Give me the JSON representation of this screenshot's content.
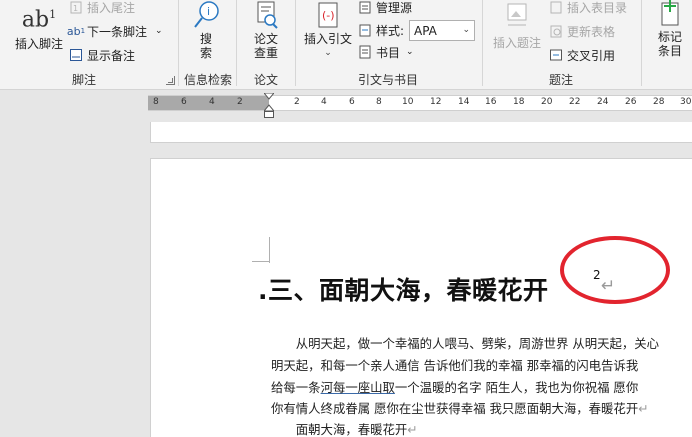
{
  "ribbon": {
    "footnotes": {
      "insert_footnote": "插入脚注",
      "insert_endnote": "插入尾注",
      "next_footnote": "下一条脚注",
      "show_notes": "显示备注",
      "group_label": "脚注"
    },
    "research": {
      "search": "搜\n索",
      "group_label": "信息检索"
    },
    "paper": {
      "check": "论文\n查重",
      "group_label": "论文"
    },
    "citations": {
      "insert_citation": "插入引文",
      "manage_sources": "管理源",
      "style_label": "样式:",
      "style_value": "APA",
      "bibliography": "书目",
      "group_label": "引文与书目"
    },
    "captions": {
      "insert_caption": "插入题注",
      "insert_table_of_figures": "插入表目录",
      "update_table": "更新表格",
      "cross_reference": "交叉引用",
      "group_label": "题注"
    },
    "index": {
      "mark_entry": "标记\n条目"
    }
  },
  "ruler": {
    "left_numbers": [
      "8",
      "6",
      "4",
      "2"
    ],
    "right_numbers": [
      "2",
      "4",
      "6",
      "8",
      "10",
      "12",
      "14",
      "16",
      "18",
      "20",
      "22",
      "24",
      "26",
      "28",
      "30"
    ]
  },
  "document": {
    "heading": ".三、面朝大海，春暖花开",
    "footnote_ref": "2",
    "paragraph_mark": "↵",
    "lines": [
      {
        "pre": "　　从明天起，做一个幸福的人喂马、劈柴，周游世界  从明天起，关心",
        "ul": "",
        "post": ""
      },
      {
        "pre": "明天起，和每一个亲人通信  告诉他们我的幸福  那幸福的闪电告诉我",
        "ul": "",
        "post": ""
      },
      {
        "pre": "给每一条",
        "ul": "河每一座山取",
        "post": "一个温暖的名字  陌生人，我也为你祝福  愿你"
      },
      {
        "pre": "你有情人终成眷属  愿你在尘世获得幸福  我只愿面朝大海，春暖花开",
        "ul": "",
        "post": ""
      },
      {
        "pre": "　　面朝大海，春暖花开",
        "ul": "",
        "post": ""
      }
    ]
  },
  "annotation": {
    "color": "#e2242e"
  }
}
